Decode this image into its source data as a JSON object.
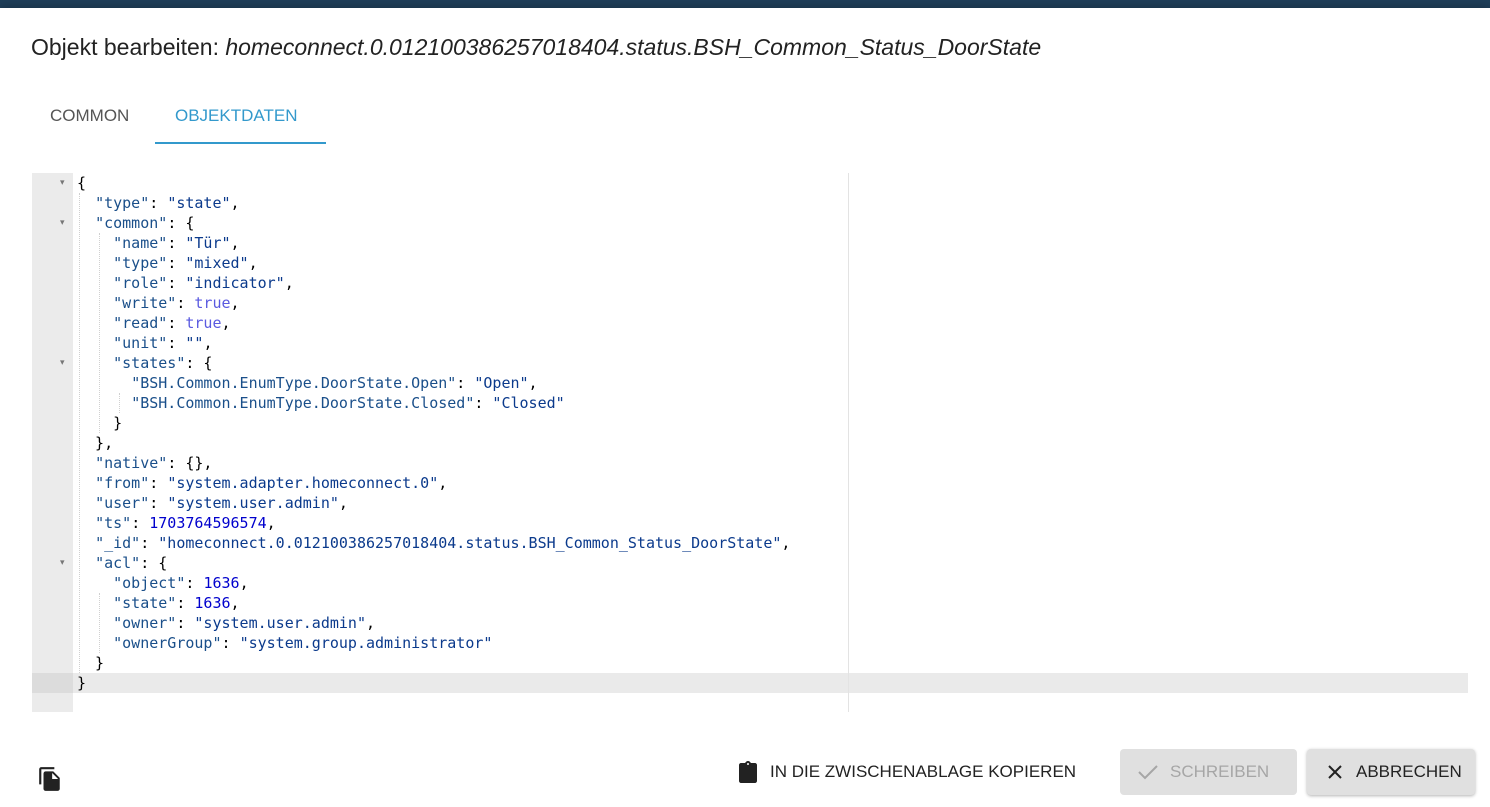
{
  "dialog": {
    "title_prefix": "Objekt bearbeiten: ",
    "object_id": "homeconnect.0.012100386257018404.status.BSH_Common_Status_DoorState"
  },
  "tabs": [
    {
      "label": "COMMON",
      "active": false
    },
    {
      "label": "OBJEKTDATEN",
      "active": true
    }
  ],
  "editor": {
    "lines": [
      "{",
      "  \"type\": \"state\",",
      "  \"common\": {",
      "    \"name\": \"Tür\",",
      "    \"type\": \"mixed\",",
      "    \"role\": \"indicator\",",
      "    \"write\": true,",
      "    \"read\": true,",
      "    \"unit\": \"\",",
      "    \"states\": {",
      "      \"BSH.Common.EnumType.DoorState.Open\": \"Open\",",
      "      \"BSH.Common.EnumType.DoorState.Closed\": \"Closed\"",
      "    }",
      "  },",
      "  \"native\": {},",
      "  \"from\": \"system.adapter.homeconnect.0\",",
      "  \"user\": \"system.user.admin\",",
      "  \"ts\": 1703764596574,",
      "  \"_id\": \"homeconnect.0.012100386257018404.status.BSH_Common_Status_DoorState\",",
      "  \"acl\": {",
      "    \"object\": 1636,",
      "    \"state\": 1636,",
      "    \"owner\": \"system.user.admin\",",
      "    \"ownerGroup\": \"system.group.administrator\"",
      "  }",
      "}"
    ],
    "fold_lines": [
      1,
      3,
      10,
      20
    ],
    "active_line": 26
  },
  "footer": {
    "copy_icon": "copy-icon",
    "clipboard_label": "IN DIE ZWISCHENABLAGE KOPIEREN",
    "write_label": "SCHREIBEN",
    "write_enabled": false,
    "cancel_label": "ABBRECHEN"
  },
  "colors": {
    "accent": "#3399cc",
    "json_key": "#1a4f8a",
    "json_string": "#0b3a8c",
    "json_number": "#0000cd",
    "json_bool": "#5a5ae0"
  }
}
